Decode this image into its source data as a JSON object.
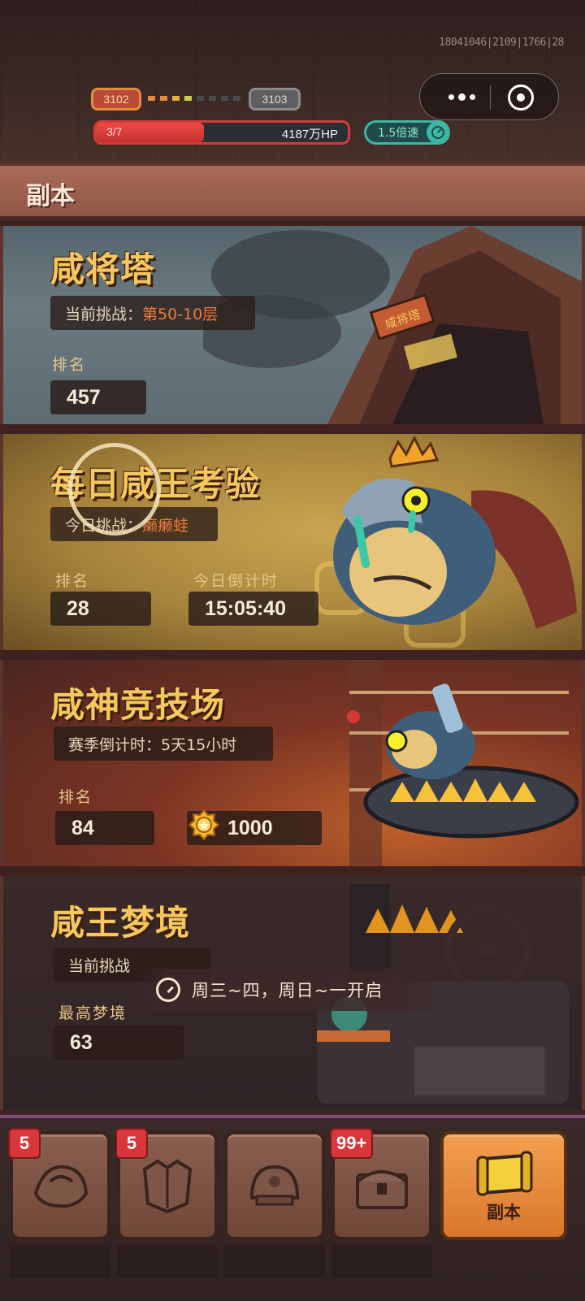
{
  "status_bar": {
    "build_id": "18041046|2109|1766|28",
    "stage_current": "3102",
    "stage_next": "3103",
    "wave": "3/7",
    "wave_progress": 0.43,
    "hp": "4187万HP",
    "speed": "1.5倍速"
  },
  "header": {
    "title": "副本"
  },
  "cards": {
    "tower": {
      "title": "咸将塔",
      "challenge_label": "当前挑战：",
      "challenge_value": "第50-10层",
      "rank_label": "排名",
      "rank_value": "457",
      "sign_text": "咸将塔"
    },
    "daily": {
      "title": "每日咸王考验",
      "challenge_label": "今日挑战：",
      "challenge_value": "癞癞蛙",
      "rank_label": "排名",
      "rank_value": "28",
      "countdown_label": "今日倒计时",
      "countdown_value": "15:05:40"
    },
    "arena": {
      "title": "咸神竞技场",
      "season_text": "赛季倒计时：5天15小时",
      "rank_label": "排名",
      "rank_value": "84",
      "reward_value": "1000"
    },
    "dream": {
      "title": "咸王梦境",
      "challenge_label": "当前挑战",
      "best_label": "最高梦境",
      "best_value": "63",
      "schedule": "周三~四，周日~一开启"
    }
  },
  "bottom_nav": {
    "items": [
      {
        "badge": "5",
        "icon": "armor-icon"
      },
      {
        "badge": "5",
        "icon": "chest-armor-icon"
      },
      {
        "badge": "",
        "icon": "helmet-icon"
      },
      {
        "badge": "99+",
        "icon": "treasure-chest-icon"
      },
      {
        "badge": "",
        "icon": "scroll-icon",
        "label": "副本",
        "active": true
      }
    ]
  },
  "colors": {
    "title_gold": "#f6c75e",
    "highlight_orange": "#ee7a3a",
    "hp_red": "#ef4a45",
    "speed_teal": "#3cb8a0",
    "active_tab": "#f2a04f"
  }
}
